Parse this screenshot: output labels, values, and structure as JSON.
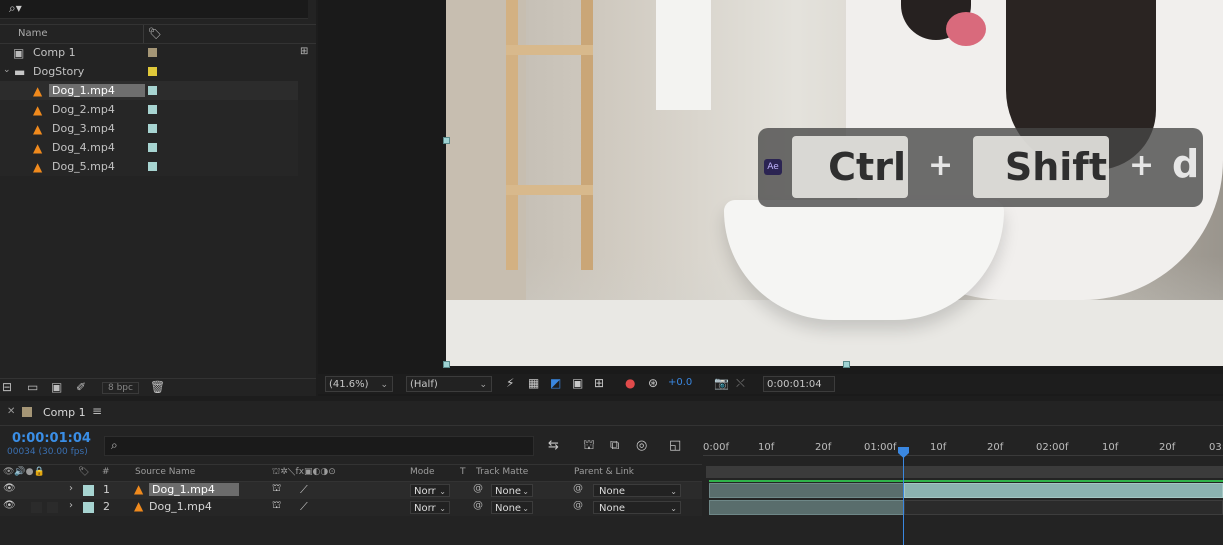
{
  "project": {
    "header": {
      "name": "Name"
    },
    "items": [
      {
        "name": "Comp 1",
        "icon": "composition-icon",
        "color": "#a59676"
      },
      {
        "name": "DogStory",
        "icon": "folder-icon",
        "color": "#e0c93a"
      },
      {
        "name": "Dog_1.mp4",
        "icon": "vlc-icon",
        "color": "#a7d4d1",
        "selected": true
      },
      {
        "name": "Dog_2.mp4",
        "icon": "vlc-icon",
        "color": "#a7d4d1"
      },
      {
        "name": "Dog_3.mp4",
        "icon": "vlc-icon",
        "color": "#a7d4d1"
      },
      {
        "name": "Dog_4.mp4",
        "icon": "vlc-icon",
        "color": "#a7d4d1"
      },
      {
        "name": "Dog_5.mp4",
        "icon": "vlc-icon",
        "color": "#a7d4d1"
      }
    ],
    "bpc": "8 bpc"
  },
  "shortcut": {
    "app": "Ae",
    "key1": "Ctrl",
    "plus": "+",
    "key2": "Shift",
    "key3": "d"
  },
  "viewer": {
    "zoom": "(41.6%)",
    "resolution": "(Half)",
    "exposure": "+0.0",
    "timecode": "0:00:01:04"
  },
  "timeline": {
    "comp_name": "Comp 1",
    "current_time": "0:00:01:04",
    "frame_info": "00034 (30.00 fps)",
    "columns": {
      "num": "#",
      "source": "Source Name",
      "mode": "Mode",
      "t": "T",
      "matte": "Track Matte",
      "parent": "Parent & Link"
    },
    "ruler": [
      "0:00f",
      "10f",
      "20f",
      "01:00f",
      "10f",
      "20f",
      "02:00f",
      "10f",
      "20f",
      "03:"
    ],
    "layers": [
      {
        "num": "1",
        "source": "Dog_1.mp4",
        "mode": "Norr",
        "matte": "None",
        "parent": "None",
        "selected": true
      },
      {
        "num": "2",
        "source": "Dog_1.mp4",
        "mode": "Norr",
        "matte": "None",
        "parent": "None",
        "selected": false
      }
    ],
    "accent": "#3a87e0"
  }
}
